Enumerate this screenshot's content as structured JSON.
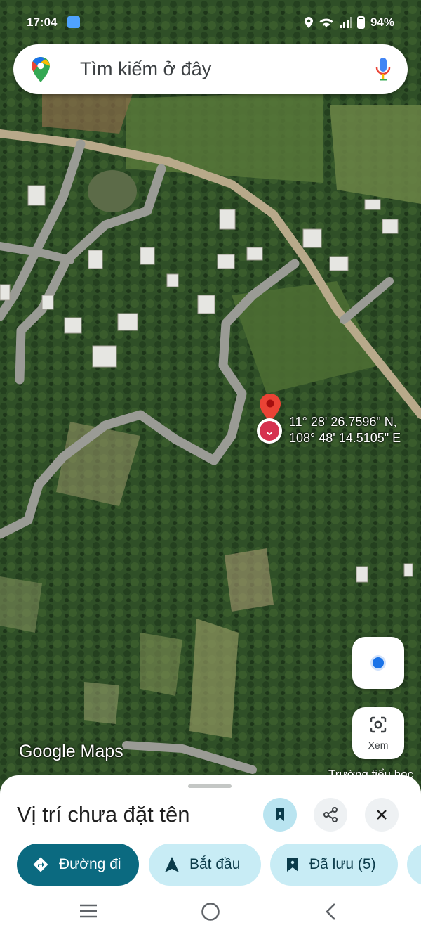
{
  "status_bar": {
    "time": "17:04",
    "battery": "94%",
    "icons": [
      "gallery-icon",
      "location-icon",
      "wifi-icon",
      "signal-icon",
      "battery-icon"
    ]
  },
  "search": {
    "placeholder": "Tìm kiếm ở đây",
    "logo": "google-maps-pin-logo",
    "mic": "mic-icon"
  },
  "map": {
    "type": "satellite",
    "marker": {
      "lat_text": "11° 28' 26.7596\" N,",
      "lon_text": "108° 48' 14.5105\" E"
    },
    "attribution": "Google Maps",
    "partial_label": "Trường tiểu học"
  },
  "controls": {
    "lens_label": "Xem"
  },
  "sheet": {
    "title": "Vị trí chưa đặt tên",
    "actions": {
      "directions": "Đường đi",
      "start": "Bắt đầu",
      "saved": "Đã lưu (5)"
    }
  },
  "colors": {
    "primary_chip": "#0b6a80",
    "secondary_chip": "#c8ecf5",
    "marker_red": "#d6324f",
    "location_blue": "#1a73e8"
  }
}
